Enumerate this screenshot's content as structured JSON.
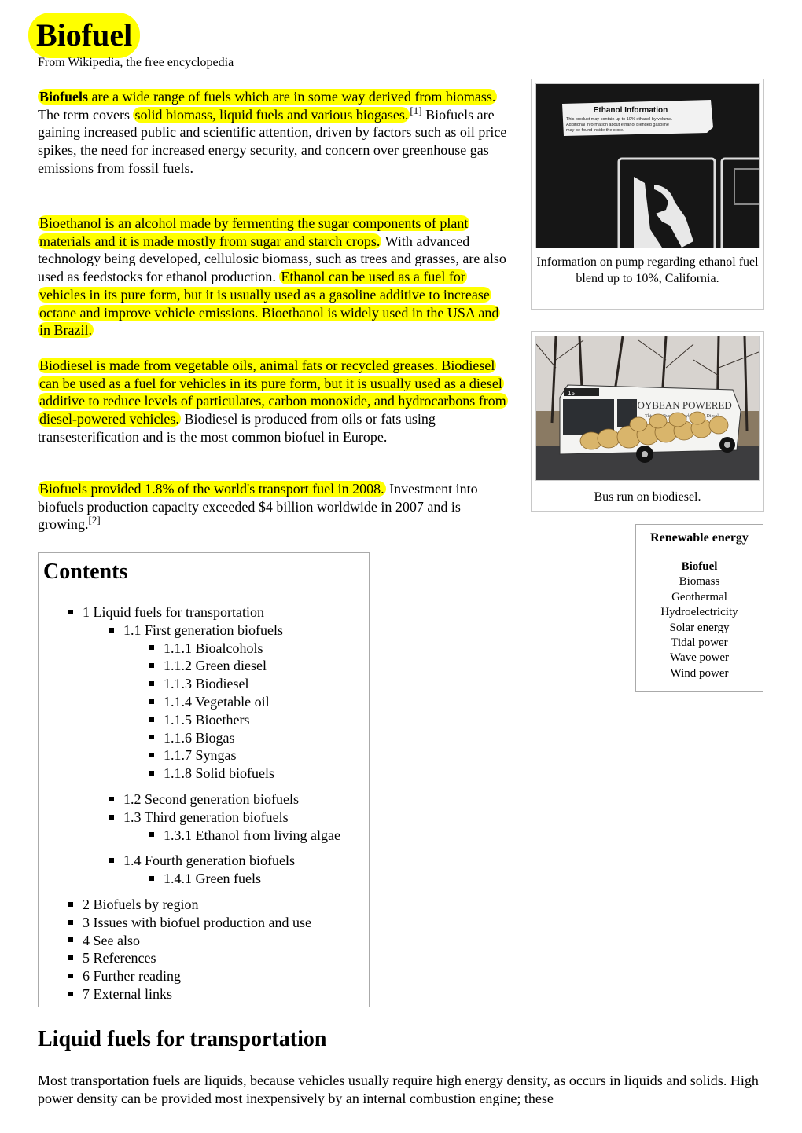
{
  "article": {
    "title": "Biofuel",
    "tagline": "From Wikipedia, the free encyclopedia"
  },
  "intro": {
    "p1": {
      "s1_bold": "Biofuels",
      "s1_rest": " are a wide range of fuels which are in some way derived from biomass.",
      "s2_plain": " The term covers ",
      "s2_hl": "solid biomass, liquid fuels and various biogases.",
      "ref1": "[1]",
      "s3": " Biofuels are gaining increased public and scientific attention, driven by factors such as oil price spikes, the need for increased energy security, and concern over greenhouse gas emissions from fossil fuels."
    },
    "p2": {
      "hl1": "Bioethanol is an alcohol made by fermenting the sugar components of plant materials and it is made mostly from sugar and starch crops.",
      "plain": " With advanced technology being developed, cellulosic biomass, such as trees and grasses, are also used as feedstocks for ethanol production. ",
      "hl2": "Ethanol can be used as a fuel for vehicles in its pure form, but it is usually used as a gasoline additive to increase octane and improve vehicle emissions. Bioethanol is widely used in the USA and in Brazil."
    },
    "p3": {
      "hl": "Biodiesel is made from vegetable oils, animal fats or recycled greases. Biodiesel can be used as a fuel for vehicles in its pure form, but it is usually used as a diesel additive to reduce levels of particulates, carbon monoxide, and hydrocarbons from diesel-powered vehicles.",
      "plain": " Biodiesel is produced from oils or fats using transesterification and is the most common biofuel in Europe."
    },
    "p4": {
      "hl": "Biofuels provided 1.8% of the world's transport fuel in 2008.",
      "plain": " Investment into biofuels production capacity exceeded $4 billion worldwide in 2007 and is growing.",
      "ref2": "[2]"
    }
  },
  "figures": [
    {
      "image_text": {
        "heading": "Ethanol Information",
        "line1": "This product may contain up to 10% ethanol by volume.",
        "line2": "Additional information about ethanol blended gasoline",
        "line3": "may be found inside the store."
      },
      "caption": "Information on pump regarding ethanol fuel blend up to 10%, California."
    },
    {
      "image_text": {
        "headline": "SOYBEAN POWERED",
        "subline": "This Bus Runs On Soybean Bio-Diesel",
        "route": "15"
      },
      "caption": "Bus run on biodiesel."
    }
  ],
  "navbox": {
    "title": "Renewable energy",
    "items": [
      "Biofuel",
      "Biomass",
      "Geothermal",
      "Hydroelectricity",
      "Solar energy",
      "Tidal power",
      "Wave power",
      "Wind power"
    ],
    "current": "Biofuel"
  },
  "toc": {
    "title": "Contents",
    "items": [
      {
        "label": "1 Liquid fuels for transportation",
        "level": 1
      },
      {
        "label": "1.1 First generation biofuels",
        "level": 2
      },
      {
        "label": "1.1.1 Bioalcohols",
        "level": 3
      },
      {
        "label": "1.1.2 Green diesel",
        "level": 3
      },
      {
        "label": "1.1.3 Biodiesel",
        "level": 3
      },
      {
        "label": "1.1.4 Vegetable oil",
        "level": 3
      },
      {
        "label": "1.1.5 Bioethers",
        "level": 3
      },
      {
        "label": "1.1.6 Biogas",
        "level": 3
      },
      {
        "label": "1.1.7 Syngas",
        "level": 3
      },
      {
        "label": "1.1.8 Solid biofuels",
        "level": 3
      },
      {
        "label": "1.2 Second generation biofuels",
        "level": 2
      },
      {
        "label": "1.3 Third generation biofuels",
        "level": 2
      },
      {
        "label": "1.3.1 Ethanol from living algae",
        "level": 3
      },
      {
        "label": "1.4 Fourth generation biofuels",
        "level": 2
      },
      {
        "label": "1.4.1 Green fuels",
        "level": 3
      },
      {
        "label": "2 Biofuels by region",
        "level": 1
      },
      {
        "label": "3 Issues with biofuel production and use",
        "level": 1
      },
      {
        "label": "4 See also",
        "level": 1
      },
      {
        "label": "5 References",
        "level": 1
      },
      {
        "label": "6 Further reading",
        "level": 1
      },
      {
        "label": "7 External links",
        "level": 1
      }
    ]
  },
  "section1": {
    "heading": "Liquid fuels for transportation",
    "body": "Most transportation fuels are liquids, because vehicles usually require high energy density, as occurs in liquids and solids. High power density can be provided most inexpensively by an internal combustion engine; these"
  },
  "colors": {
    "highlight": "#ffff00",
    "border": "#aaaaaa"
  }
}
